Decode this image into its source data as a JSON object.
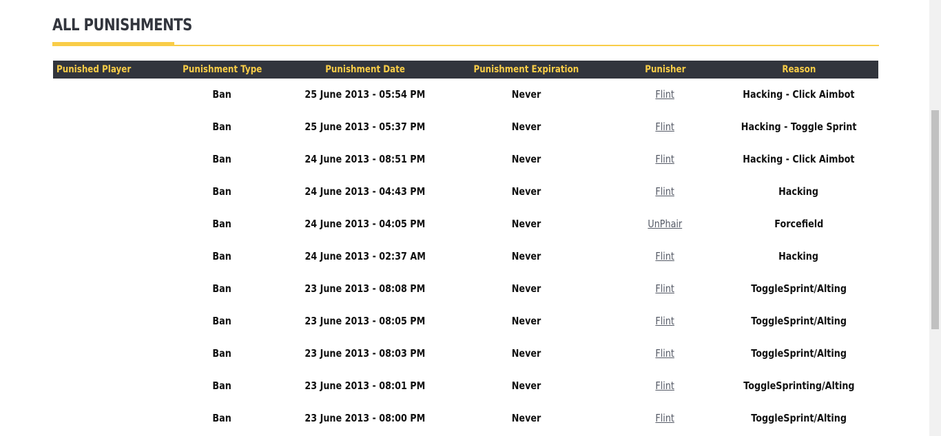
{
  "section": {
    "title": "ALL PUNISHMENTS"
  },
  "table": {
    "headers": {
      "player": "Punished Player",
      "type": "Punishment Type",
      "date": "Punishment Date",
      "expiration": "Punishment Expiration",
      "punisher": "Punisher",
      "reason": "Reason"
    },
    "rows": [
      {
        "player": "",
        "type": "Ban",
        "date": "25 June 2013 - 05:54 PM",
        "expiration": "Never",
        "punisher": "Flint",
        "reason": "Hacking - Click Aimbot"
      },
      {
        "player": "",
        "type": "Ban",
        "date": "25 June 2013 - 05:37 PM",
        "expiration": "Never",
        "punisher": "Flint",
        "reason": "Hacking - Toggle Sprint"
      },
      {
        "player": "",
        "type": "Ban",
        "date": "24 June 2013 - 08:51 PM",
        "expiration": "Never",
        "punisher": "Flint",
        "reason": "Hacking - Click Aimbot"
      },
      {
        "player": "",
        "type": "Ban",
        "date": "24 June 2013 - 04:43 PM",
        "expiration": "Never",
        "punisher": "Flint",
        "reason": "Hacking"
      },
      {
        "player": "",
        "type": "Ban",
        "date": "24 June 2013 - 04:05 PM",
        "expiration": "Never",
        "punisher": "UnPhair",
        "reason": "Forcefield"
      },
      {
        "player": "",
        "type": "Ban",
        "date": "24 June 2013 - 02:37 AM",
        "expiration": "Never",
        "punisher": "Flint",
        "reason": "Hacking"
      },
      {
        "player": "",
        "type": "Ban",
        "date": "23 June 2013 - 08:08 PM",
        "expiration": "Never",
        "punisher": "Flint",
        "reason": "ToggleSprint/Alting"
      },
      {
        "player": "",
        "type": "Ban",
        "date": "23 June 2013 - 08:05 PM",
        "expiration": "Never",
        "punisher": "Flint",
        "reason": "ToggleSprint/Alting"
      },
      {
        "player": "",
        "type": "Ban",
        "date": "23 June 2013 - 08:03 PM",
        "expiration": "Never",
        "punisher": "Flint",
        "reason": "ToggleSprint/Alting"
      },
      {
        "player": "",
        "type": "Ban",
        "date": "23 June 2013 - 08:01 PM",
        "expiration": "Never",
        "punisher": "Flint",
        "reason": "ToggleSprinting/Alting"
      },
      {
        "player": "",
        "type": "Ban",
        "date": "23 June 2013 - 08:00 PM",
        "expiration": "Never",
        "punisher": "Flint",
        "reason": "ToggleSprint/Alting"
      }
    ]
  },
  "colors": {
    "accent": "#f9cd48",
    "header_bg": "#32353d",
    "title_text": "#32353d",
    "cell_text": "#111111",
    "link_text": "#555a66"
  }
}
